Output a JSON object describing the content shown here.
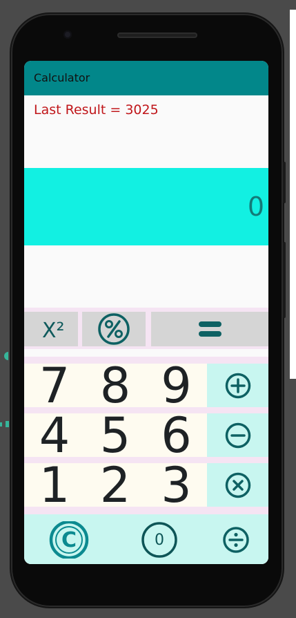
{
  "app": {
    "title": "Calculator"
  },
  "last_result": {
    "text": "Last Result = 3025"
  },
  "display": {
    "value": "0"
  },
  "function_row": {
    "square_label": "X²",
    "percent_icon": "percent-icon",
    "equals_icon": "equals-icon"
  },
  "keypad": {
    "row1": [
      "7",
      "8",
      "9"
    ],
    "row2": [
      "4",
      "5",
      "6"
    ],
    "row3": [
      "1",
      "2",
      "3"
    ],
    "operators": [
      "plus-icon",
      "minus-icon",
      "multiply-icon",
      "divide-icon"
    ]
  },
  "bottom": {
    "clear_label": "C",
    "zero_label": "0"
  },
  "colors": {
    "app_bar": "#02878a",
    "display_bg": "#12f0e2",
    "display_text": "#137a78",
    "last_result_text": "#c0161a",
    "operator_bg": "#c8f6f0",
    "digit_bg": "#fefbf0"
  }
}
